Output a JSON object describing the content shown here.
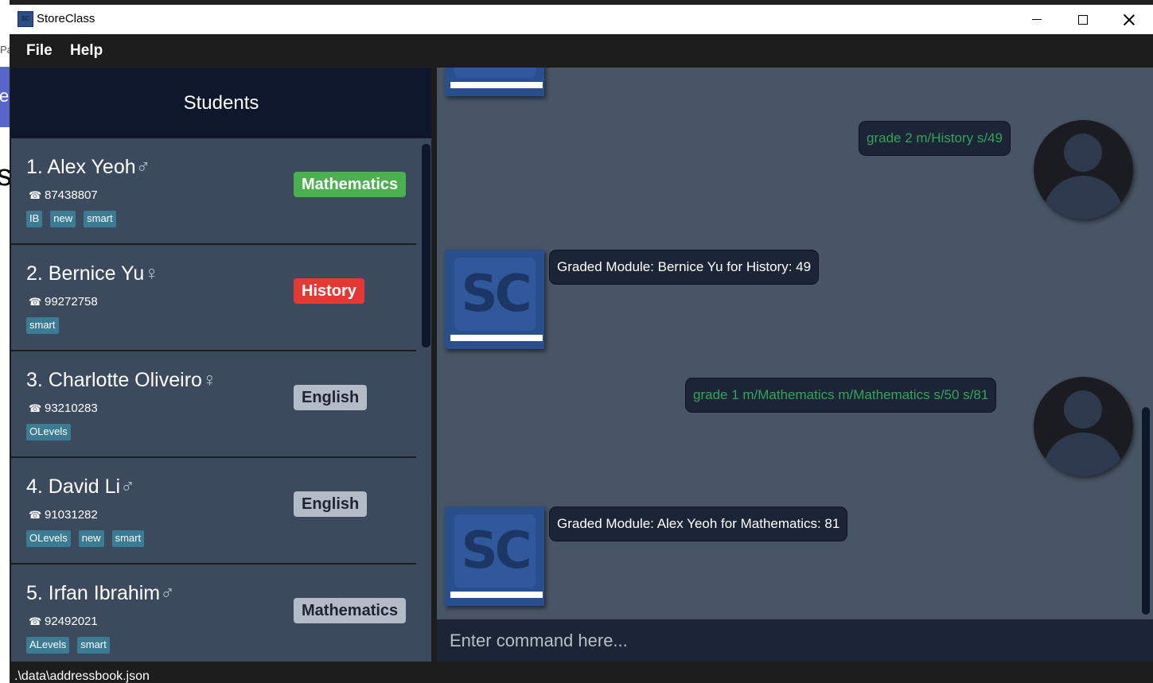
{
  "desktop": {
    "left_text_1": "Pa",
    "left_text_2": "er",
    "left_text_3": "s"
  },
  "window": {
    "title": "StoreClass",
    "icon_label": "SC"
  },
  "menu": {
    "file": "File",
    "help": "Help"
  },
  "student_list": {
    "title": "Students",
    "students": [
      {
        "name": "1. Alex Yeoh",
        "gender_symbol": "♂",
        "phone": "87438807",
        "tags": [
          "IB",
          "new",
          "smart"
        ],
        "module": "Mathematics",
        "module_color": "#4caf50",
        "module_text_color": "#ffffff"
      },
      {
        "name": "2. Bernice Yu",
        "gender_symbol": "♀",
        "phone": "99272758",
        "tags": [
          "smart"
        ],
        "module": "History",
        "module_color": "#e53935",
        "module_text_color": "#ffffff"
      },
      {
        "name": "3. Charlotte Oliveiro",
        "gender_symbol": "♀",
        "phone": "93210283",
        "tags": [
          "OLevels"
        ],
        "module": "English",
        "module_color": "#b3bcc6",
        "module_text_color": "#1d2530"
      },
      {
        "name": "4. David Li",
        "gender_symbol": "♂",
        "phone": "91031282",
        "tags": [
          "OLevels",
          "new",
          "smart"
        ],
        "module": "English",
        "module_color": "#b3bcc6",
        "module_text_color": "#1d2530"
      },
      {
        "name": "5. Irfan Ibrahim",
        "gender_symbol": "♂",
        "phone": "92492021",
        "tags": [
          "ALevels",
          "smart"
        ],
        "module": "Mathematics",
        "module_color": "#b3bcc6",
        "module_text_color": "#1d2530"
      }
    ]
  },
  "chat": {
    "messages": [
      {
        "sender": "user",
        "text": "grade 2 m/History s/49"
      },
      {
        "sender": "bot",
        "text": "Graded Module: Bernice Yu for History: 49"
      },
      {
        "sender": "user",
        "text": "grade 1 m/Mathematics m/Mathematics s/50 s/81"
      },
      {
        "sender": "bot",
        "text": "Graded Module: Alex Yeoh for Mathematics: 81"
      }
    ]
  },
  "command_box": {
    "placeholder": "Enter command here...",
    "value": ""
  },
  "status_bar": {
    "path": ".\\data\\addressbook.json"
  },
  "colors": {
    "header_bg": "#0e172b",
    "card_bg": "#3b4a5c",
    "chat_bg": "#485565",
    "tag_bg": "#3b7b94",
    "user_command_text": "#35a25a"
  }
}
